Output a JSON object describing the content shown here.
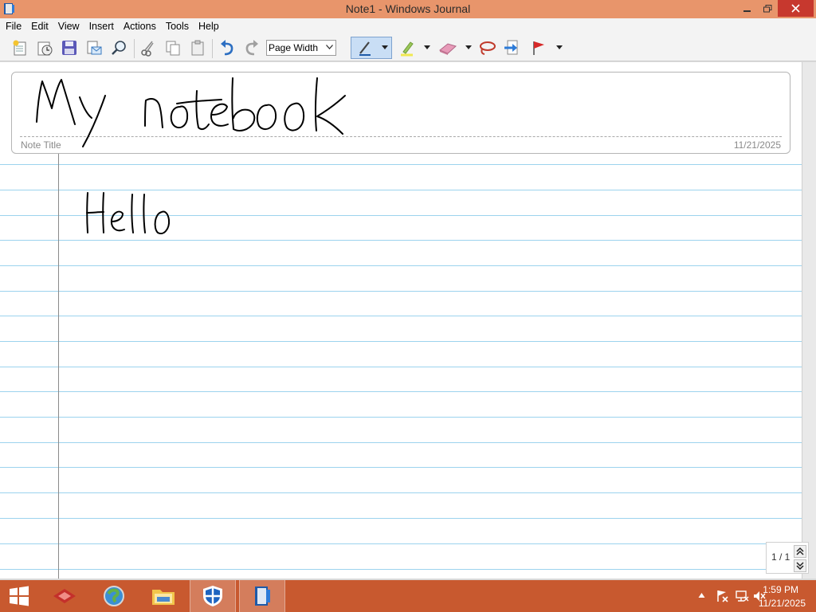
{
  "window": {
    "title": "Note1 - Windows Journal",
    "minimize_glyph": "—",
    "maximize_glyph": "❐",
    "close_glyph": "✕"
  },
  "menu": [
    "File",
    "Edit",
    "View",
    "Insert",
    "Actions",
    "Tools",
    "Help"
  ],
  "toolbar": {
    "zoom_value": "Page Width",
    "icons": [
      "new-note-icon",
      "open-icon",
      "save-icon",
      "send-email-icon",
      "find-icon",
      "cut-icon",
      "copy-icon",
      "paste-icon",
      "undo-icon",
      "redo-icon",
      "pen-icon",
      "highlighter-icon",
      "eraser-icon",
      "lasso-select-icon",
      "insert-space-icon",
      "flag-icon"
    ]
  },
  "note": {
    "title_label": "Note Title",
    "date": "11/21/2025",
    "handwritten_title": "My notebook",
    "handwritten_body": "Hello"
  },
  "pager": {
    "page_text": "1 / 1"
  },
  "taskbar": {
    "time": "1:59 PM",
    "date": "11/21/2025",
    "apps": [
      "start-button",
      "toolbox-app-icon",
      "browser-app-icon",
      "file-explorer-app-icon",
      "defender-app-icon",
      "windows-journal-app-icon"
    ]
  },
  "colors": {
    "titlebar": "#e8956b",
    "close_button": "#c7382e",
    "taskbar": "#c8592f",
    "ruled_line": "#9cd3ee",
    "ink": "#000000"
  }
}
